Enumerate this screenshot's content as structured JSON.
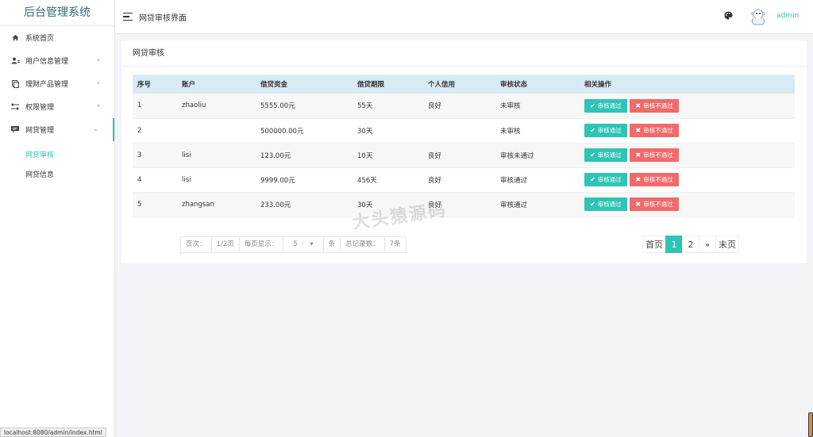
{
  "app": {
    "title": "后台管理系统"
  },
  "sidebar": {
    "items": [
      {
        "label": "系统首页",
        "icon": "home-icon",
        "chevron": ""
      },
      {
        "label": "用户信息管理",
        "icon": "users-icon",
        "chevron": "›"
      },
      {
        "label": "理财产品管理",
        "icon": "product-icon",
        "chevron": "›"
      },
      {
        "label": "权限管理",
        "icon": "permission-icon",
        "chevron": "›"
      },
      {
        "label": "网贷管理",
        "icon": "loan-icon",
        "chevron": "⌄"
      }
    ],
    "subitems": [
      {
        "label": "网贷审核",
        "active": true
      },
      {
        "label": "网贷信息",
        "active": false
      }
    ]
  },
  "header": {
    "title": "网贷审核界面",
    "username": "admin"
  },
  "card": {
    "title": "网贷审核"
  },
  "table": {
    "columns": [
      "序号",
      "账户",
      "借贷资金",
      "借贷期限",
      "个人信用",
      "审核状态",
      "相关操作"
    ],
    "approve_label": "审核通过",
    "reject_label": "审核不通过",
    "rows": [
      [
        "1",
        "zhaoliu",
        "5555.00元",
        "55天",
        "良好",
        "未审核"
      ],
      [
        "2",
        "",
        "500000.00元",
        "30天",
        "",
        "未审核"
      ],
      [
        "3",
        "lisi",
        "123.00元",
        "10天",
        "良好",
        "审核未通过"
      ],
      [
        "4",
        "lisi",
        "9999.00元",
        "456天",
        "良好",
        "审核通过"
      ],
      [
        "5",
        "zhangsan",
        "233.00元",
        "30天",
        "良好",
        "审核通过"
      ]
    ]
  },
  "pager": {
    "page_label": "页次：",
    "page_value": "1/2页",
    "per_page_label": "每页显示：",
    "per_page_value": "5",
    "per_page_unit": "条",
    "total_label": "总记录数：",
    "total_value": "7条",
    "first": "首页",
    "pages": [
      "1",
      "2"
    ],
    "next": "»",
    "last": "末页"
  },
  "watermark": "大头猿源码",
  "status_url": "localhost:8080/admin/index.html",
  "colors": {
    "accent": "#2ec4b6",
    "danger": "#f06a6a",
    "table_header": "#d8ebf4"
  }
}
